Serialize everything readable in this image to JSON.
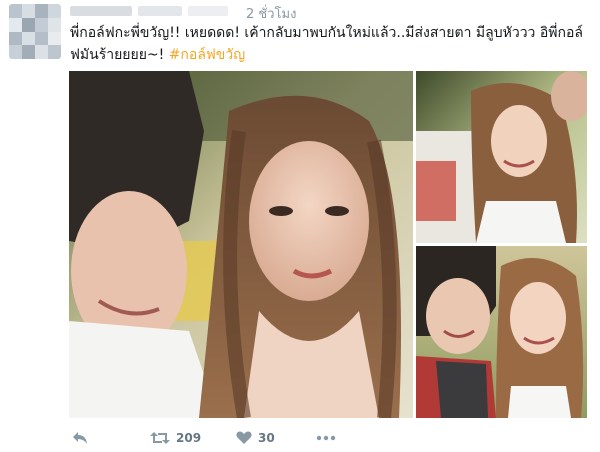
{
  "tweet": {
    "timestamp": "2 ชั่วโมง",
    "text_line1": "พี่กอล์ฟกะพี่ขวัญ!! เหยดดด! เค้ากลับมาพบกันใหม่แล้ว..มีส่งสายตา มีลูบหัววว อิพี่กอล์",
    "text_line2_prefix": "ฟมันร้ายยยย~! ",
    "hashtag": "#กอล์ฟขวัญ"
  },
  "actions": {
    "reply_icon": "reply-icon",
    "retweet_icon": "retweet-icon",
    "retweet_count": "209",
    "like_icon": "heart-icon",
    "like_count": "30",
    "more_icon": "more-icon"
  },
  "colors": {
    "text": "#14171a",
    "muted": "#8899a6",
    "hashtag": "#f5a623",
    "background": "#ffffff"
  }
}
